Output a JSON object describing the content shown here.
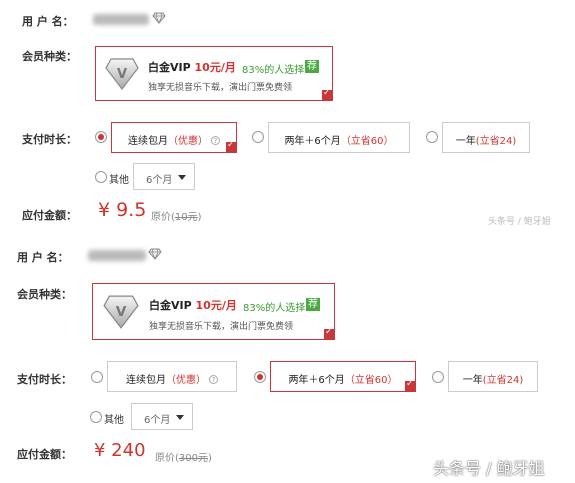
{
  "labels": {
    "username": "用 户 名：",
    "member_type": "会员种类：",
    "duration": "支付时长：",
    "amount": "应付金额："
  },
  "vip": {
    "title": "白金VIP",
    "price": "10元/月",
    "pct": "83%的人选择",
    "tag": "荐",
    "desc": "独享无损音乐下载，演出门票免费领",
    "logo_letter": "V"
  },
  "options": {
    "monthly_label": "连续包月",
    "monthly_note": "（优惠）",
    "two_year_label": "两年＋6个月",
    "two_year_note": "（立省60）",
    "one_year_label": "一年",
    "one_year_note": "(立省24)",
    "other_label": "其他",
    "dropdown_value": "6个月"
  },
  "top": {
    "amount": "¥ 9.5",
    "orig_prefix": "原价(",
    "orig_value": "10元",
    "orig_suffix": ")",
    "selected": "monthly"
  },
  "bottom": {
    "amount": "¥ 240",
    "orig_prefix": "原价(",
    "orig_value": "300元",
    "orig_suffix": ")",
    "selected": "two_year"
  },
  "watermark": {
    "small": "头条号 / 鲍牙姐",
    "big": "头条号 / 鲍牙姐"
  },
  "colors": {
    "accent_red": "#d2322d",
    "recommend_green": "#4aa93f"
  }
}
